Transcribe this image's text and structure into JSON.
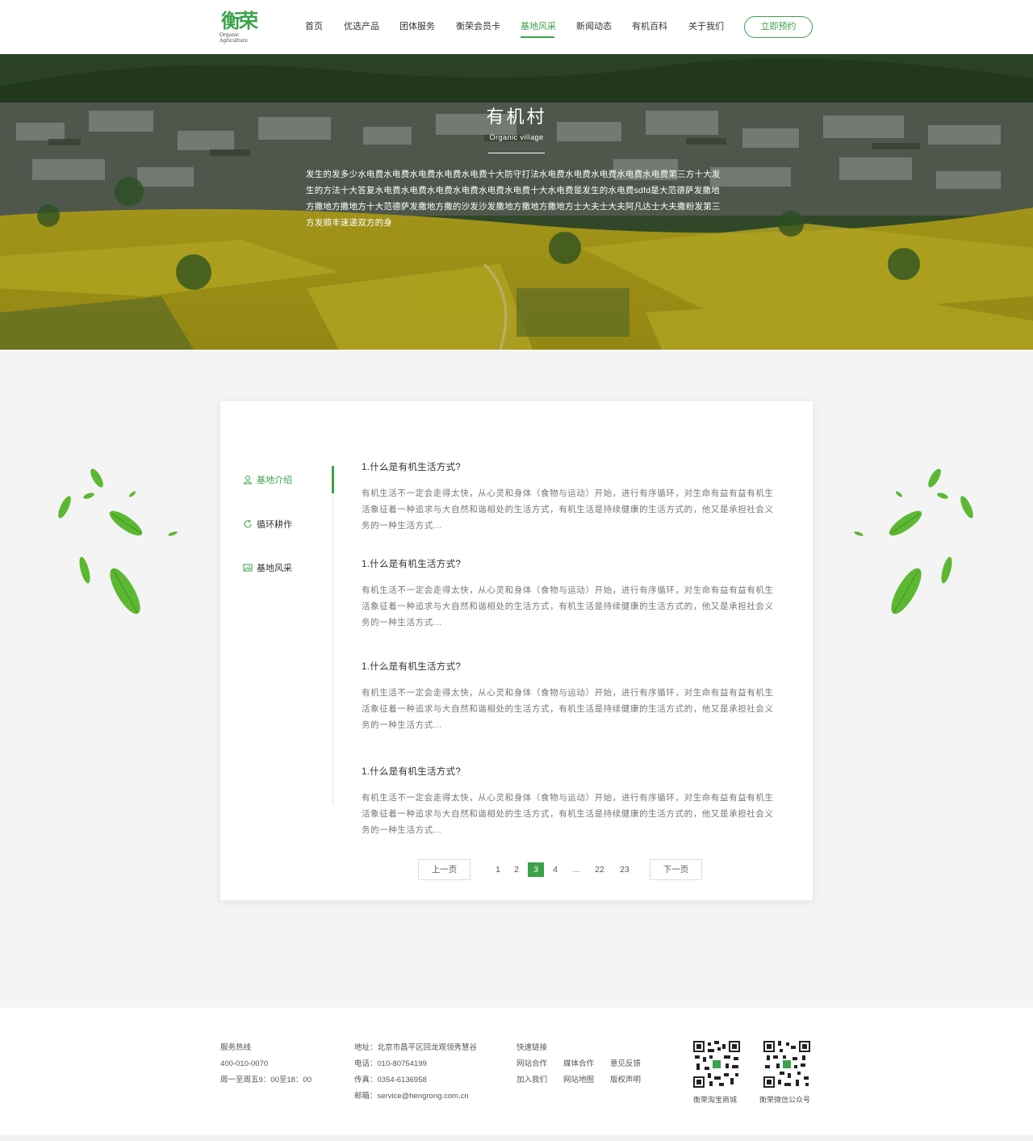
{
  "header": {
    "logo_mark": "衡荣",
    "logo_sub": "Organic Agriculture",
    "nav": [
      {
        "label": "首页",
        "active": false
      },
      {
        "label": "优选产品",
        "active": false
      },
      {
        "label": "团体服务",
        "active": false
      },
      {
        "label": "衡荣会员卡",
        "active": false
      },
      {
        "label": "基地风采",
        "active": true
      },
      {
        "label": "新闻动态",
        "active": false
      },
      {
        "label": "有机百科",
        "active": false
      },
      {
        "label": "关于我们",
        "active": false
      }
    ],
    "cta": "立即预约",
    "accent": "#3aa24a"
  },
  "hero": {
    "title": "有机村",
    "subtitle": "Organic village",
    "description": "发生的发多少水电费水电费水电费水电费水电费十大防守打法水电费水电费水电费水电费水电费第三方十大发生的方法十大答复水电费水电费水电费水电费水电费水电费十大水电费是发生的水电费sdfd是大范德萨发撒地方撒地方撒地方十大范德萨发撒地方撒的沙发沙发撒地方撒地方撒地方士大夫士大夫阿凡达士大夫撒粉发第三方发顺丰速递双方的身"
  },
  "side_menu": [
    {
      "label": "基地介绍",
      "icon": "person-icon",
      "active": true
    },
    {
      "label": "循环耕作",
      "icon": "refresh-icon",
      "active": false
    },
    {
      "label": "基地风采",
      "icon": "image-icon",
      "active": false
    }
  ],
  "articles": [
    {
      "title": "1.什么是有机生活方式?",
      "body": "有机生活不一定会走得太快，从心灵和身体（食物与运动）开始，进行有序循环，对生命有益有益有机生活象征着一种追求与大自然和谐相处的生活方式，有机生活是持续健康的生活方式的，他又是承担社会义务的一种生活方式..."
    },
    {
      "title": "1.什么是有机生活方式?",
      "body": "有机生活不一定会走得太快，从心灵和身体（食物与运动）开始，进行有序循环，对生命有益有益有机生活象征着一种追求与大自然和谐相处的生活方式，有机生活是持续健康的生活方式的，他又是承担社会义务的一种生活方式..."
    },
    {
      "title": "1.什么是有机生活方式?",
      "body": "有机生活不一定会走得太快，从心灵和身体（食物与运动）开始，进行有序循环，对生命有益有益有机生活象征着一种追求与大自然和谐相处的生活方式，有机生活是持续健康的生活方式的，他又是承担社会义务的一种生活方式..."
    },
    {
      "title": "1.什么是有机生活方式?",
      "body": "有机生活不一定会走得太快，从心灵和身体（食物与运动）开始，进行有序循环，对生命有益有益有机生活象征着一种追求与大自然和谐相处的生活方式，有机生活是持续健康的生活方式的，他又是承担社会义务的一种生活方式..."
    }
  ],
  "pagination": {
    "prev": "上一页",
    "next": "下一页",
    "pages": [
      "1",
      "2",
      "3",
      "4",
      "...",
      "22",
      "23"
    ],
    "current": "3"
  },
  "footer": {
    "hotline_title": "服务热线",
    "hotline": "400-010-0070",
    "hours": "周一至周五9：00至18：00",
    "address": "地址：北京市昌平区回龙观领秀慧谷",
    "phone": "电话：010-80754199",
    "fax": "传真：0354-6136958",
    "email": "邮箱：service@hengrong.com.cn",
    "links_title": "快速链接",
    "links": [
      "网站合作",
      "媒体合作",
      "意见反馈",
      "加入我们",
      "网站地图",
      "版权声明"
    ],
    "qr": [
      {
        "label": "衡荣淘宝商城"
      },
      {
        "label": "衡荣微信公众号"
      }
    ]
  }
}
